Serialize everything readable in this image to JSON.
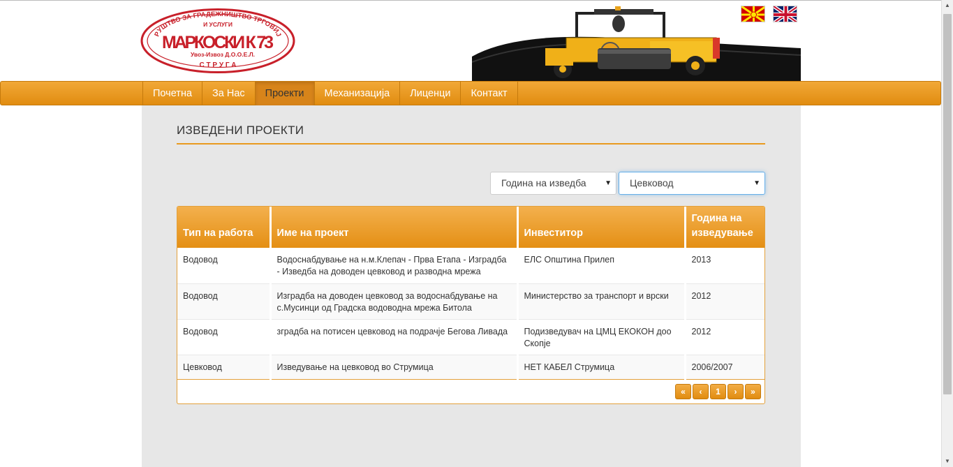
{
  "brand": {
    "logo_line1": "ДРУШТВО ЗА ГРАДЕЖНИШТВО ТРГОВИЈА",
    "logo_line2": "И УСЛУГИ",
    "logo_name": "МАРКОСКИ К 73",
    "logo_sub": "Увоз-Извоз Д.О.О.Е.Л.",
    "logo_city": "С Т Р У Г А"
  },
  "languages": [
    {
      "code": "mk",
      "icon": "macedonia-flag-icon"
    },
    {
      "code": "en",
      "icon": "uk-flag-icon"
    }
  ],
  "nav": {
    "items": [
      {
        "label": "Почетна"
      },
      {
        "label": "За Нас"
      },
      {
        "label": "Проекти"
      },
      {
        "label": "Механизација"
      },
      {
        "label": "Лиценци"
      },
      {
        "label": "Контакт"
      }
    ],
    "active": "Проекти"
  },
  "page": {
    "title": "ИЗВЕДЕНИ ПРОЕКТИ"
  },
  "filters": {
    "year_selected": "Година на изведба",
    "type_selected": "Цевковод"
  },
  "table": {
    "headers": [
      "Тип на работа",
      "Име на проект",
      "Инвеститор",
      "Година на изведување"
    ],
    "rows": [
      [
        "Водовод",
        "Водоснабдување на н.м.Клепач - Прва Етапа - Изградба - Изведба на доводен цевковод и разводна мрежа",
        "ЕЛС Општина Прилеп",
        "2013"
      ],
      [
        "Водовод",
        "Изградба на доводен цевковод за водоснабдување на с.Мусинци од Градска водоводна мрежа Битола",
        "Министерство за транспорт и врски",
        "2012"
      ],
      [
        "Водовод",
        "зградба на потисен цевковод на подрачје Бегова Ливада",
        "Подизведувач на ЦМЦ ЕКОКОН доо Скопје",
        "2012"
      ],
      [
        "Цевковод",
        "Изведување на цевковод во Струмица",
        "НЕТ КАБЕЛ Струмица",
        "2006/2007"
      ]
    ]
  },
  "pagination": {
    "first": "«",
    "prev": "‹",
    "current": "1",
    "next": "›",
    "last": "»"
  },
  "colors": {
    "accent": "#e99a1f",
    "nav_gradient_top": "#f1a837",
    "nav_gradient_bottom": "#e18c10",
    "logo_red": "#c8202a",
    "content_bg": "#e7e7e7"
  }
}
